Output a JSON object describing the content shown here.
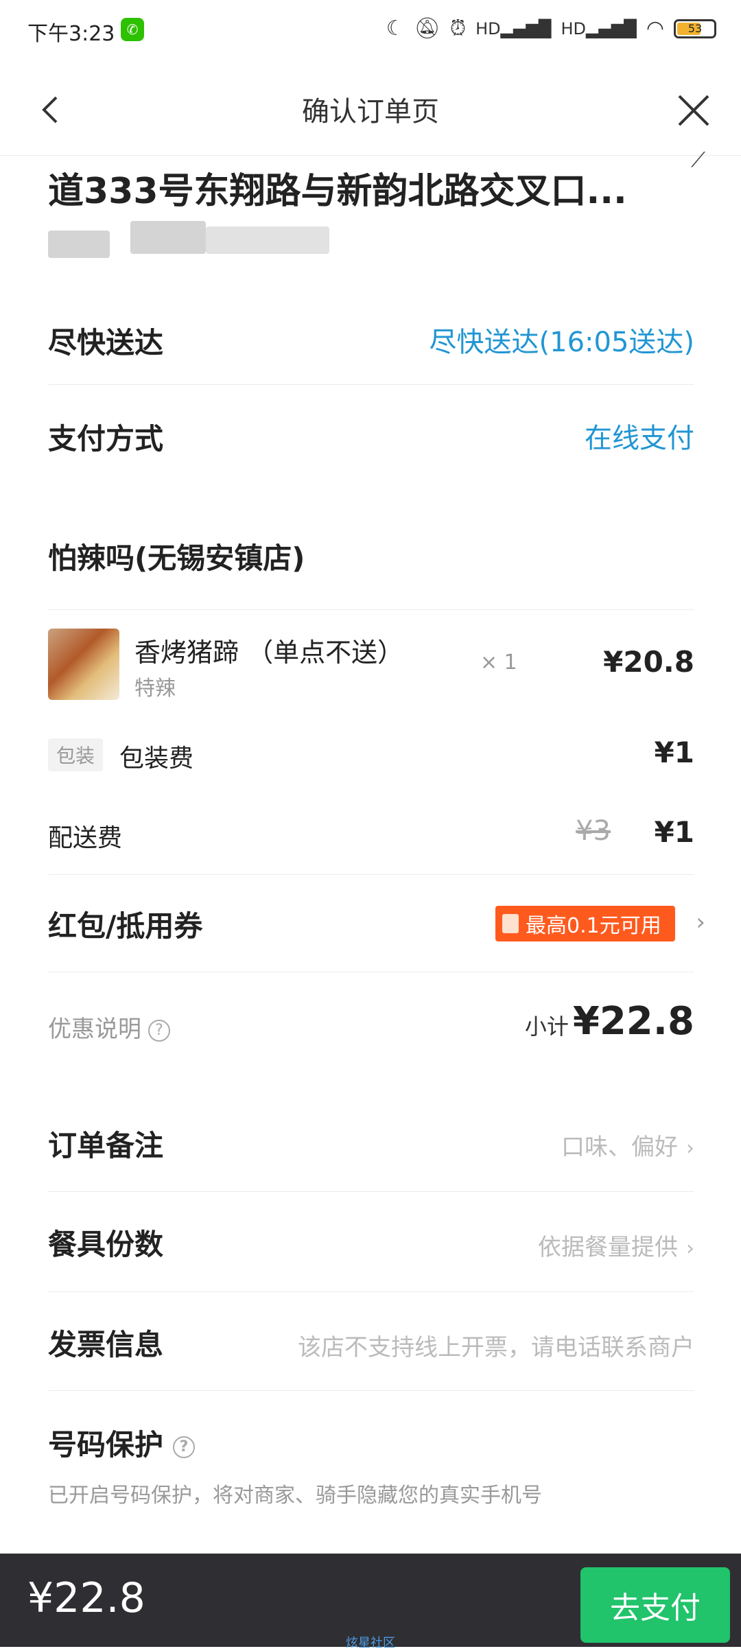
{
  "status": {
    "time": "下午3:23",
    "battery": "53"
  },
  "nav": {
    "title": "确认订单页"
  },
  "address": {
    "line": "道333号东翔路与新韵北路交叉口..."
  },
  "delivery": {
    "label": "尽快送达",
    "value": "尽快送达(16:05送达)"
  },
  "payment": {
    "label": "支付方式",
    "value": "在线支付"
  },
  "shop": {
    "name": "怕辣吗(无锡安镇店)"
  },
  "item": {
    "name": "香烤猪蹄 （单点不送）",
    "spec": "特辣",
    "qty": "× 1",
    "price": "¥20.8"
  },
  "packing": {
    "tag": "包装",
    "label": "包装费",
    "price": "¥1"
  },
  "delivery_fee": {
    "label": "配送费",
    "original": "¥3",
    "price": "¥1"
  },
  "coupon": {
    "label": "红包/抵用券",
    "badge": "最高0.1元可用"
  },
  "discount": {
    "label": "优惠说明",
    "subtotal_label": "小计",
    "subtotal": "¥22.8"
  },
  "remark": {
    "label": "订单备注",
    "value": "口味、偏好"
  },
  "tableware": {
    "label": "餐具份数",
    "value": "依据餐量提供"
  },
  "invoice": {
    "label": "发票信息",
    "value": "该店不支持线上开票，请电话联系商户"
  },
  "privacy": {
    "label": "号码保护",
    "desc": "已开启号码保护，将对商家、骑手隐藏您的真实手机号"
  },
  "footer": {
    "total": "¥22.8",
    "pay_button": "去支付",
    "watermark": "炫星社区"
  },
  "colors": {
    "accent_blue": "#2196d3",
    "coupon_orange": "#ff5a1e",
    "pay_green": "#21c36b",
    "bottom_bar": "#2f2f33"
  }
}
